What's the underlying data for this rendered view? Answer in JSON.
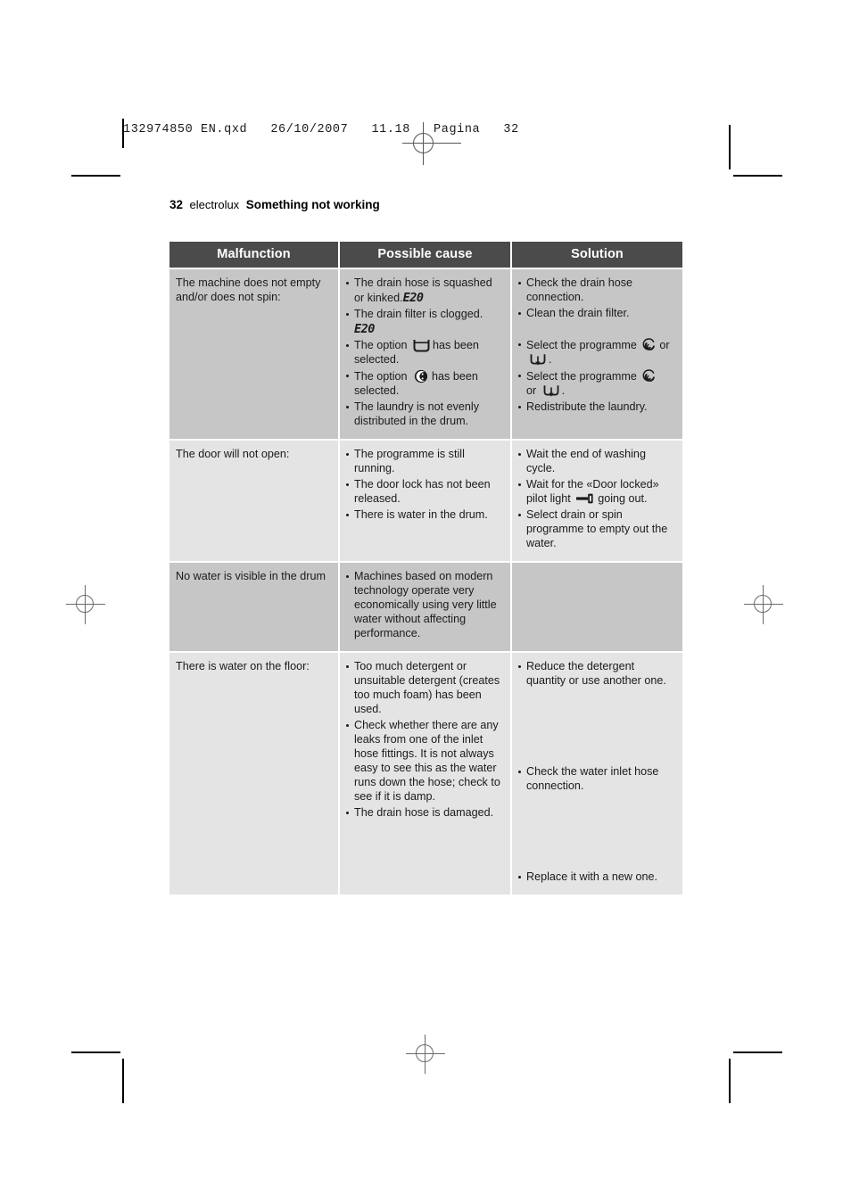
{
  "printers_slug": "132974850 EN.qxd   26/10/2007   11.18   Pagina   32",
  "running_head": {
    "page_number": "32",
    "brand": "electrolux",
    "section": "Something not working"
  },
  "table": {
    "headers": [
      "Malfunction",
      "Possible cause",
      "Solution"
    ],
    "header_bg": "#4b4b4b",
    "header_text_color": "#ffffff",
    "row_bg_odd": "#c6c6c6",
    "row_bg_even": "#e4e4e4",
    "rows": [
      {
        "malfunction": "The machine does not empty and/or does not spin:",
        "causes": [
          {
            "text_before": "The drain hose is squashed or kinked.",
            "code": "E20",
            "text_after": ""
          },
          {
            "text_before": "The drain filter is clogged.",
            "code": "E20",
            "text_after": ""
          },
          {
            "text_before": "The option",
            "icon": "rinse-hold-icon",
            "text_after": "has been selected."
          },
          {
            "text_before": "The option",
            "icon": "night-cycle-icon",
            "text_after": "has been selected."
          },
          {
            "text_before": "The laundry is not evenly distributed in the drum.",
            "text_after": ""
          }
        ],
        "solutions": [
          {
            "text_before": "Check the drain hose connection.",
            "text_after": ""
          },
          {
            "text_before": "Clean the drain filter.",
            "text_after": ""
          },
          {
            "text_before": "Select the programme",
            "icon": "spin-icon",
            "mid": "or",
            "icon2": "drain-icon",
            "text_after": "."
          },
          {
            "text_before": "Select the programme",
            "icon": "spin-icon",
            "mid": "or",
            "icon2": "drain-icon",
            "text_after": "."
          },
          {
            "text_before": "Redistribute the laundry.",
            "text_after": ""
          }
        ]
      },
      {
        "malfunction": "The door will not open:",
        "causes": [
          {
            "text_before": "The programme is still running.",
            "text_after": ""
          },
          {
            "text_before": "The door lock has not been released.",
            "text_after": ""
          },
          {
            "text_before": "There is water in the drum.",
            "text_after": ""
          }
        ],
        "solutions": [
          {
            "text_before": "Wait the end of washing cycle.",
            "text_after": ""
          },
          {
            "text_before": "Wait for the «Door locked» pilot light",
            "icon": "door-lock-key-icon",
            "text_after": "going out."
          },
          {
            "text_before": "Select drain or spin programme to empty out the water.",
            "text_after": ""
          }
        ]
      },
      {
        "malfunction": "No water is visible in the drum",
        "causes": [
          {
            "text_before": "Machines based on modern technology operate very economically using very little water without affecting performance.",
            "text_after": ""
          }
        ],
        "solutions": []
      },
      {
        "malfunction": "There is water on the floor:",
        "causes": [
          {
            "text_before": "Too much detergent or unsuitable detergent (creates too much foam) has been used.",
            "text_after": ""
          },
          {
            "text_before": "Check whether there are any leaks from one of the inlet hose fittings. It is not always easy to see this as the water runs down the hose; check to see if it is damp.",
            "text_after": ""
          },
          {
            "text_before": "The drain hose is damaged.",
            "text_after": ""
          }
        ],
        "solutions": [
          {
            "text_before": "Reduce the detergent quantity or use another one.",
            "text_after": ""
          },
          {
            "text_before": "Check the water inlet hose connection.",
            "text_after": ""
          },
          {
            "text_before": "Replace it with a new one.",
            "text_after": ""
          }
        ]
      }
    ]
  }
}
